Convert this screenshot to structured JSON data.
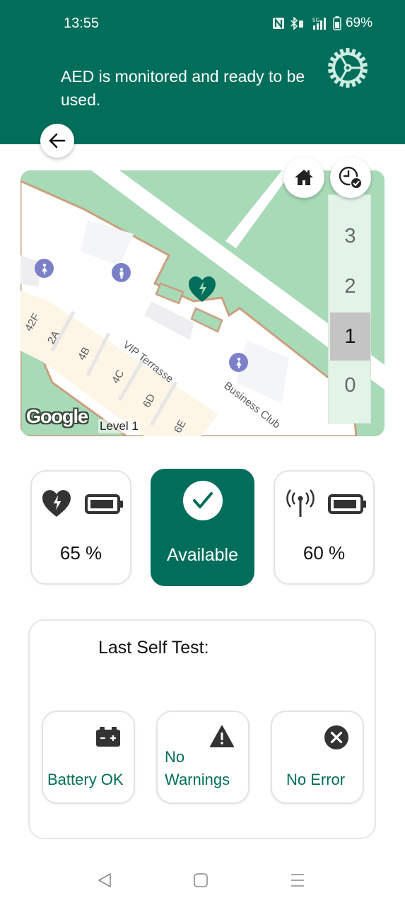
{
  "status_bar": {
    "time": "13:55",
    "icons": [
      "nfc-icon",
      "bluetooth-icon",
      "5g-signal-icon",
      "battery-icon"
    ],
    "network": "5G",
    "battery_percent": "69%"
  },
  "header": {
    "message": "AED is monitored and ready to be used.",
    "settings_icon": "gear-icon",
    "back_icon": "arrow-left-icon"
  },
  "map": {
    "attribution": "Google",
    "level_label": "Level 1",
    "labels": {
      "vip_terrasse": "VIP Terrasse",
      "business_club": "Business Club",
      "room_42f": "42F",
      "room_2a": "2A",
      "room_4b": "4B",
      "room_4c": "4C",
      "room_6d": "6D",
      "room_6e": "6E"
    },
    "buttons": {
      "home_icon": "home-icon",
      "history_icon": "clock-check-icon"
    },
    "floors": [
      "3",
      "2",
      "1",
      "0"
    ],
    "active_floor": "1",
    "colors": {
      "park": "#a8dab8",
      "building": "#ffffff",
      "rooms": "#fdf6e6",
      "outline": "#c9a07f",
      "poi": "#7b80c8",
      "aed_marker": "#006e5a"
    }
  },
  "status_cards": {
    "aed_battery": {
      "icon": "heart-lightning-icon",
      "battery_icon": "battery-icon",
      "value": "65 %",
      "percent": 65
    },
    "availability": {
      "icon": "check-circle-icon",
      "label": "Available"
    },
    "connectivity_battery": {
      "icon": "antenna-signal-icon",
      "battery_icon": "battery-icon",
      "value": "60 %",
      "percent": 60
    }
  },
  "self_test": {
    "title": "Last Self Test:",
    "items": [
      {
        "icon": "car-battery-icon",
        "label": "Battery OK"
      },
      {
        "icon": "warning-triangle-icon",
        "label_line1": "No",
        "label_line2": "Warnings"
      },
      {
        "icon": "x-circle-icon",
        "label": "No Error"
      }
    ]
  },
  "nav_bar": {
    "back": "triangle-back-icon",
    "home": "square-home-icon",
    "recents": "menu-lines-icon"
  },
  "colors": {
    "primary": "#006e5a",
    "header_text": "#ffffff",
    "accent_text": "#006e5a"
  }
}
